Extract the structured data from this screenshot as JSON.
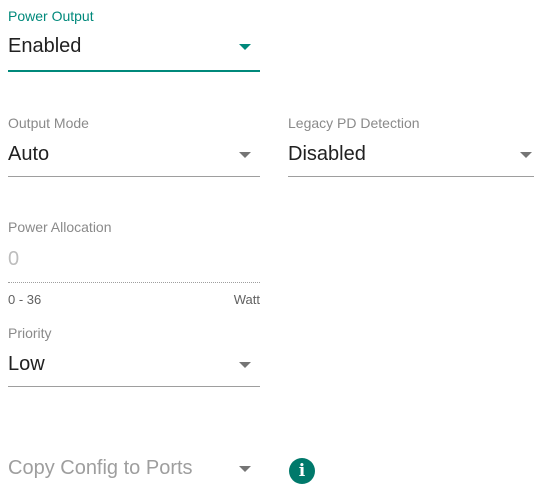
{
  "power_output": {
    "label": "Power Output",
    "value": "Enabled",
    "state": "focused",
    "icon": "dropdown-arrow-icon"
  },
  "output_mode": {
    "label": "Output Mode",
    "value": "Auto",
    "icon": "dropdown-arrow-icon"
  },
  "legacy_pd_detection": {
    "label": "Legacy PD Detection",
    "value": "Disabled",
    "icon": "dropdown-arrow-icon"
  },
  "power_allocation": {
    "label": "Power Allocation",
    "value": "0",
    "state": "disabled",
    "range_hint": "0 - 36",
    "unit": "Watt"
  },
  "priority": {
    "label": "Priority",
    "value": "Low",
    "icon": "dropdown-arrow-icon"
  },
  "copy_config": {
    "placeholder": "Copy Config to Ports",
    "icon": "dropdown-arrow-icon",
    "info_icon": "info-icon",
    "info_glyph": "i"
  },
  "colors": {
    "accent": "#00897b",
    "info": "#00796b",
    "label": "#8a8a8a",
    "text": "#212121",
    "disabled_text": "#bdbdbd",
    "placeholder": "#9e9e9e"
  }
}
